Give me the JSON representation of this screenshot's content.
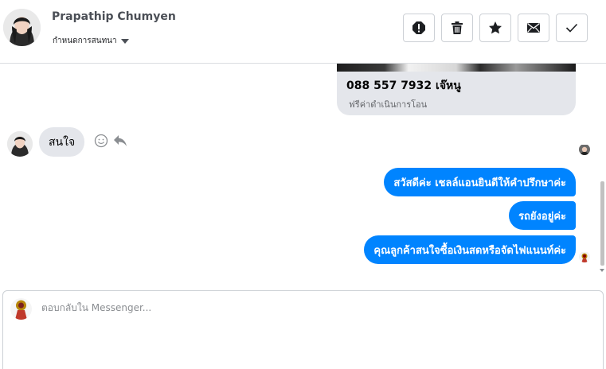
{
  "header": {
    "contact_name": "Prapathip Chumyen",
    "status_label": "กำหนดการสนทนา",
    "actions": [
      {
        "name": "alert-icon",
        "label": "Mark as spam"
      },
      {
        "name": "trash-icon",
        "label": "Delete"
      },
      {
        "name": "star-icon",
        "label": "Star"
      },
      {
        "name": "envelope-icon",
        "label": "Mark as unread"
      },
      {
        "name": "check-icon",
        "label": "Mark as done"
      }
    ]
  },
  "thread": {
    "shared_card": {
      "title": "088 557 7932 เจ๊หนู",
      "subtitle": "ฟรีค่าดำเนินการโอน"
    },
    "incoming_message": "สนใจ",
    "outgoing_messages": [
      "สวัสดีค่ะ เชลล์แอนยินดีให้คำปรึกษาค่ะ",
      "รถยังอยู่ค่ะ",
      "คุณลูกค้าสนใจซื้อเงินสดหรือจัดไฟแนนท์ค่ะ"
    ]
  },
  "composer": {
    "placeholder": "ตอบกลับใน Messenger..."
  },
  "colors": {
    "accent": "#0084ff",
    "incoming_bubble": "#e4e6eb",
    "border": "#ccd0d5"
  }
}
